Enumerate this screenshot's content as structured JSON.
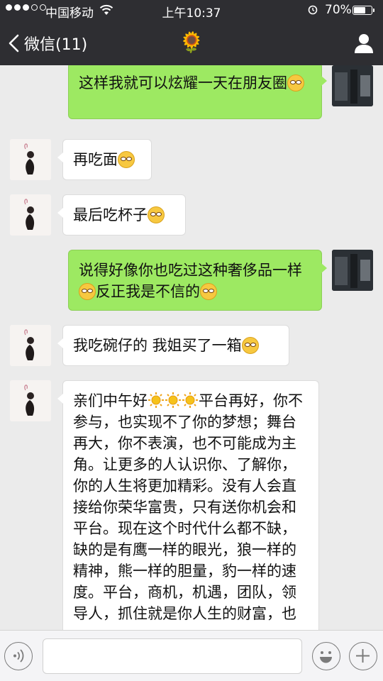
{
  "status_bar": {
    "carrier": "中国移动",
    "time": "上午10:37",
    "battery_percent": "70%",
    "battery_level": 0.7
  },
  "nav": {
    "back_label": "微信(11)",
    "title_emoji": "🌻"
  },
  "messages": [
    {
      "side": "right",
      "text": "这样我就可以炫耀一天在朋友圈",
      "emoji_after": true
    },
    {
      "side": "left",
      "text": "再吃面",
      "emoji_after": true
    },
    {
      "side": "left",
      "text": "最后吃杯子",
      "emoji_after": true
    },
    {
      "side": "right",
      "text_parts": [
        "说得好像你也吃过这种奢侈品一样",
        "反正我是不信的"
      ]
    },
    {
      "side": "left",
      "text": "我吃碗仔的 我姐买了一箱",
      "emoji_after": true
    },
    {
      "side": "left",
      "text_lead": "亲们中午好",
      "text": "平台再好，你不参与，也实现不了你的梦想；舞台再大，你不表演，也不可能成为主角。让更多的人认识你、了解你，你的人生将更加精彩。没有人会直接给你荣华富贵，只有送你机会和平台。现在这个时代什么都不缺，缺的是有鹰一样的眼光，狼一样的精神，熊一样的胆量，豹一样的速度。平台，商机，机遇，团队，领导人，抓住就是你人生的财富，也"
    }
  ],
  "input_bar": {
    "voice_icon": "voice-icon",
    "emoji_icon": "emoji-icon",
    "plus_icon": "plus-icon"
  },
  "colors": {
    "header_bg": "#2e2e32",
    "chat_bg": "#ebebeb",
    "sent_bubble": "#9de962",
    "received_bubble": "#ffffff"
  }
}
